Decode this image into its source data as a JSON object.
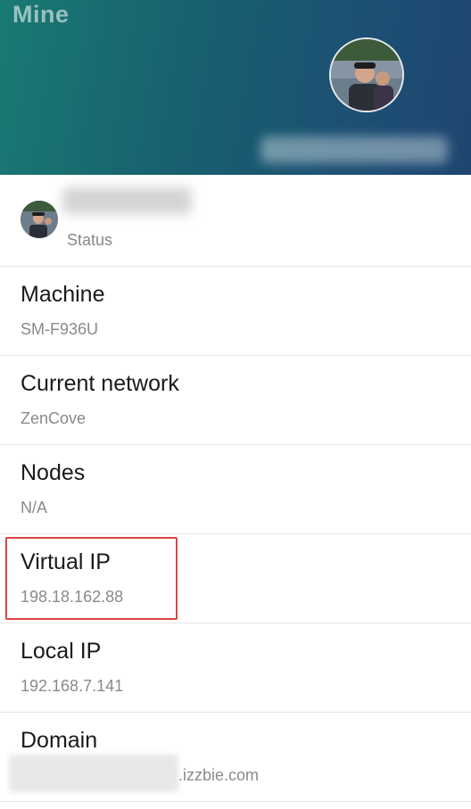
{
  "header": {
    "title": "Mine"
  },
  "profile": {
    "status_label": "Status"
  },
  "items": [
    {
      "title": "Machine",
      "value": "SM-F936U"
    },
    {
      "title": "Current network",
      "value": "ZenCove"
    },
    {
      "title": "Nodes",
      "value": "N/A"
    },
    {
      "title": "Virtual IP",
      "value": "198.18.162.88"
    },
    {
      "title": "Local IP",
      "value": "192.168.7.141"
    },
    {
      "title": "Domain",
      "value": ".izzbie.com"
    }
  ],
  "colors": {
    "header_gradient_start": "#1a7a72",
    "header_gradient_end": "#1e4670",
    "highlight_border": "#e04444"
  }
}
